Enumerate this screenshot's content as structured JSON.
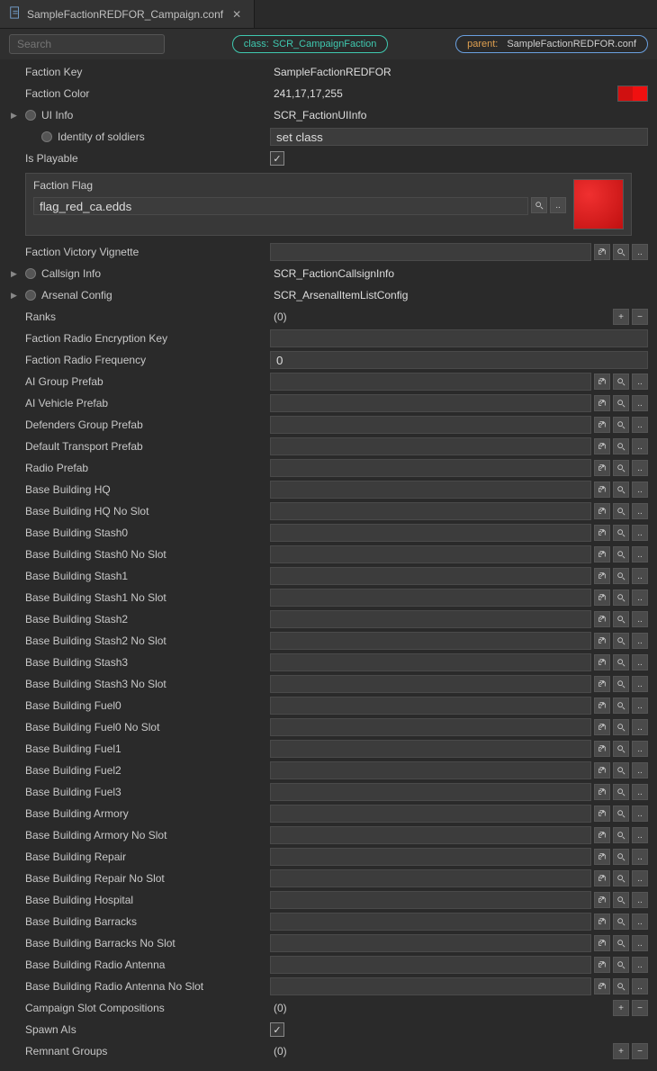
{
  "tab": {
    "title": "SampleFactionREDFOR_Campaign.conf"
  },
  "search": {
    "placeholder": "Search"
  },
  "chips": {
    "class_prefix": "class:",
    "class_value": "SCR_CampaignFaction",
    "parent_prefix": "parent:",
    "parent_value": "SampleFactionREDFOR.conf"
  },
  "flag": {
    "label": "Faction Flag",
    "value": "flag_red_ca.edds"
  },
  "rows": [
    {
      "label": "Faction Key",
      "type": "text",
      "value": "SampleFactionREDFOR"
    },
    {
      "label": "Faction Color",
      "type": "color",
      "value": "241,17,17,255"
    },
    {
      "label": "UI Info",
      "type": "class",
      "value": "SCR_FactionUIInfo",
      "expandable": true,
      "dot": true
    },
    {
      "label": "Identity of soldiers",
      "type": "setclass",
      "value": "set class",
      "indent": true,
      "dot": true
    },
    {
      "label": "Is Playable",
      "type": "checkbox",
      "checked": true
    },
    {
      "label": "__FLAGBOX__",
      "type": "flagbox"
    },
    {
      "label": "Faction Victory Vignette",
      "type": "asset",
      "value": ""
    },
    {
      "label": "Callsign Info",
      "type": "class",
      "value": "SCR_FactionCallsignInfo",
      "expandable": true,
      "dot": true
    },
    {
      "label": "Arsenal Config",
      "type": "class",
      "value": "SCR_ArsenalItemListConfig",
      "expandable": true,
      "dot": true
    },
    {
      "label": "Ranks",
      "type": "array",
      "value": "(0)"
    },
    {
      "label": "Faction Radio Encryption Key",
      "type": "input",
      "value": ""
    },
    {
      "label": "Faction Radio Frequency",
      "type": "input",
      "value": "0"
    },
    {
      "label": "AI Group Prefab",
      "type": "asset",
      "value": ""
    },
    {
      "label": "AI Vehicle Prefab",
      "type": "asset",
      "value": ""
    },
    {
      "label": "Defenders Group Prefab",
      "type": "asset",
      "value": ""
    },
    {
      "label": "Default Transport Prefab",
      "type": "asset",
      "value": ""
    },
    {
      "label": "Radio Prefab",
      "type": "asset",
      "value": ""
    },
    {
      "label": "Base Building HQ",
      "type": "asset",
      "value": ""
    },
    {
      "label": "Base Building HQ No Slot",
      "type": "asset",
      "value": ""
    },
    {
      "label": "Base Building Stash0",
      "type": "asset",
      "value": ""
    },
    {
      "label": "Base Building Stash0 No Slot",
      "type": "asset",
      "value": ""
    },
    {
      "label": "Base Building Stash1",
      "type": "asset",
      "value": ""
    },
    {
      "label": "Base Building Stash1 No Slot",
      "type": "asset",
      "value": ""
    },
    {
      "label": "Base Building Stash2",
      "type": "asset",
      "value": ""
    },
    {
      "label": "Base Building Stash2 No Slot",
      "type": "asset",
      "value": ""
    },
    {
      "label": "Base Building Stash3",
      "type": "asset",
      "value": ""
    },
    {
      "label": "Base Building Stash3 No Slot",
      "type": "asset",
      "value": ""
    },
    {
      "label": "Base Building Fuel0",
      "type": "asset",
      "value": ""
    },
    {
      "label": "Base Building Fuel0 No Slot",
      "type": "asset",
      "value": ""
    },
    {
      "label": "Base Building Fuel1",
      "type": "asset",
      "value": ""
    },
    {
      "label": "Base Building Fuel2",
      "type": "asset",
      "value": ""
    },
    {
      "label": "Base Building Fuel3",
      "type": "asset",
      "value": ""
    },
    {
      "label": "Base Building Armory",
      "type": "asset",
      "value": ""
    },
    {
      "label": "Base Building Armory No Slot",
      "type": "asset",
      "value": ""
    },
    {
      "label": "Base Building Repair",
      "type": "asset",
      "value": ""
    },
    {
      "label": "Base Building Repair No Slot",
      "type": "asset",
      "value": ""
    },
    {
      "label": "Base Building Hospital",
      "type": "asset",
      "value": ""
    },
    {
      "label": "Base Building Barracks",
      "type": "asset",
      "value": ""
    },
    {
      "label": "Base Building Barracks No Slot",
      "type": "asset",
      "value": ""
    },
    {
      "label": "Base Building Radio Antenna",
      "type": "asset",
      "value": ""
    },
    {
      "label": "Base Building Radio Antenna No Slot",
      "type": "asset",
      "value": ""
    },
    {
      "label": "Campaign Slot Compositions",
      "type": "array",
      "value": "(0)"
    },
    {
      "label": "Spawn AIs",
      "type": "checkbox",
      "checked": true
    },
    {
      "label": "Remnant Groups",
      "type": "array",
      "value": "(0)"
    }
  ]
}
